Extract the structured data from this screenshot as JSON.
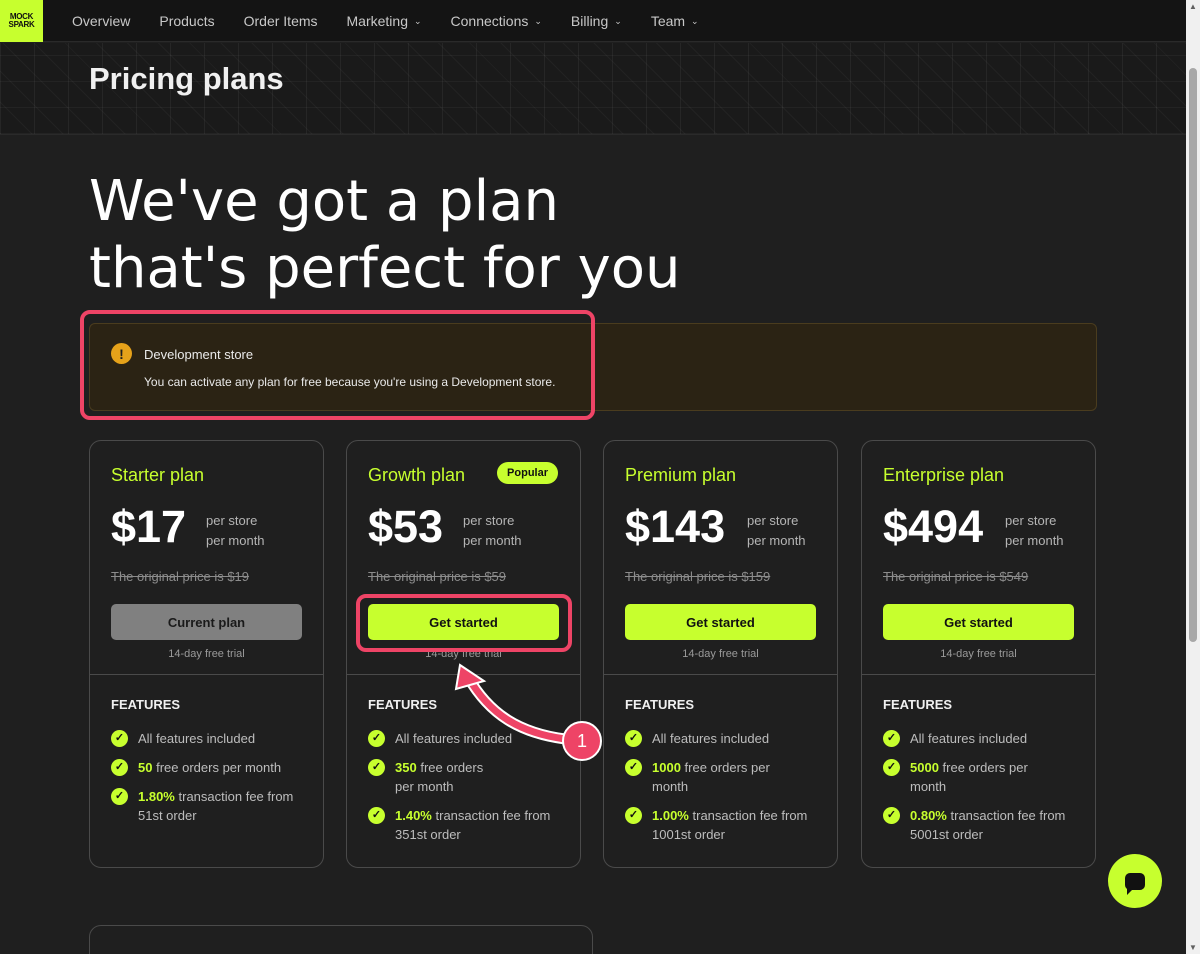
{
  "brand": {
    "logo_text": "MOCK SPARK",
    "accent": "#c7ff2e"
  },
  "nav": {
    "items": [
      {
        "label": "Overview",
        "dropdown": false
      },
      {
        "label": "Products",
        "dropdown": false
      },
      {
        "label": "Order Items",
        "dropdown": false
      },
      {
        "label": "Marketing",
        "dropdown": true
      },
      {
        "label": "Connections",
        "dropdown": true
      },
      {
        "label": "Billing",
        "dropdown": true
      },
      {
        "label": "Team",
        "dropdown": true
      }
    ]
  },
  "page": {
    "title": "Pricing plans",
    "hero_line1": "We've got a plan",
    "hero_line2": "that's perfect for you"
  },
  "alert": {
    "icon": "warning-icon",
    "title": "Development store",
    "text": "You can activate any plan for free because you're using a Development store."
  },
  "plans": [
    {
      "name": "Starter plan",
      "badge": "",
      "price": "$17",
      "per_line1": "per store",
      "per_line2": "per month",
      "original": "The original price is $19",
      "cta": "Current plan",
      "trial": "14-day free trial",
      "features_heading": "FEATURES",
      "f1": "All features included",
      "f2_value": "50",
      "f2_text": "free orders per month",
      "f3_value": "1.80%",
      "f3_text": "transaction fee from 51st order"
    },
    {
      "name": "Growth plan",
      "badge": "Popular",
      "price": "$53",
      "per_line1": "per store",
      "per_line2": "per month",
      "original": "The original price is $59",
      "cta": "Get started",
      "trial": "14-day free trial",
      "features_heading": "FEATURES",
      "f1": "All features included",
      "f2_value": "350",
      "f2_text": "free orders per month",
      "f3_value": "1.40%",
      "f3_text": "transaction fee from 351st order"
    },
    {
      "name": "Premium plan",
      "badge": "",
      "price": "$143",
      "per_line1": "per store",
      "per_line2": "per month",
      "original": "The original price is $159",
      "cta": "Get started",
      "trial": "14-day free trial",
      "features_heading": "FEATURES",
      "f1": "All features included",
      "f2_value": "1000",
      "f2_text": "free orders per month",
      "f3_value": "1.00%",
      "f3_text": "transaction fee from 1001st order"
    },
    {
      "name": "Enterprise plan",
      "badge": "",
      "price": "$494",
      "per_line1": "per store",
      "per_line2": "per month",
      "original": "The original price is $549",
      "cta": "Get started",
      "trial": "14-day free trial",
      "features_heading": "FEATURES",
      "f1": "All features included",
      "f2_value": "5000",
      "f2_text": "free orders per month",
      "f3_value": "0.80%",
      "f3_text": "transaction fee from 5001st order"
    }
  ],
  "annotation": {
    "step_number": "1",
    "color": "#ee4466"
  },
  "chat": {
    "icon": "chat-icon"
  }
}
